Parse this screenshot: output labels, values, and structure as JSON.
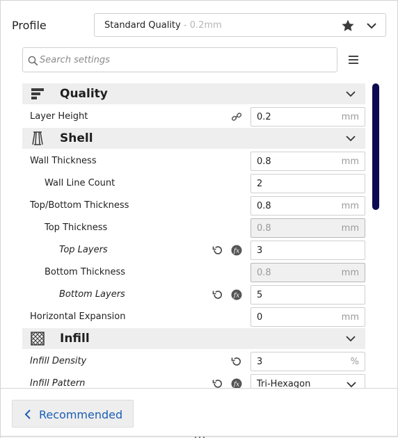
{
  "profile": {
    "label": "Profile",
    "selected_name": "Standard Quality",
    "selected_sub": " - 0.2mm",
    "icons": [
      "star-icon",
      "chevron-down-icon"
    ]
  },
  "search": {
    "placeholder": "Search settings",
    "value": ""
  },
  "categories": {
    "quality": {
      "title": "Quality",
      "icon": "quality-icon"
    },
    "shell": {
      "title": "Shell",
      "icon": "shell-icon"
    },
    "infill": {
      "title": "Infill",
      "icon": "infill-icon"
    }
  },
  "settings": {
    "layer_height": {
      "label": "Layer Height",
      "value": "0.2",
      "unit": "mm"
    },
    "wall_thickness": {
      "label": "Wall Thickness",
      "value": "0.8",
      "unit": "mm"
    },
    "wall_line_count": {
      "label": "Wall Line Count",
      "value": "2"
    },
    "top_bottom_thickness": {
      "label": "Top/Bottom Thickness",
      "value": "0.8",
      "unit": "mm"
    },
    "top_thickness": {
      "label": "Top Thickness",
      "value": "0.8",
      "unit": "mm"
    },
    "top_layers": {
      "label": "Top Layers",
      "value": "3"
    },
    "bottom_thickness": {
      "label": "Bottom Thickness",
      "value": "0.8",
      "unit": "mm"
    },
    "bottom_layers": {
      "label": "Bottom Layers",
      "value": "5"
    },
    "horizontal_expansion": {
      "label": "Horizontal Expansion",
      "value": "0",
      "unit": "mm"
    },
    "infill_density": {
      "label": "Infill Density",
      "value": "3",
      "unit": "%"
    },
    "infill_pattern": {
      "label": "Infill Pattern",
      "value": "Tri-Hexagon"
    }
  },
  "footer": {
    "recommended_label": "Recommended"
  },
  "colors": {
    "accent_blue": "#1b5db4",
    "scrollbar": "#0d0b4f",
    "category_bg": "#eeeeee"
  }
}
